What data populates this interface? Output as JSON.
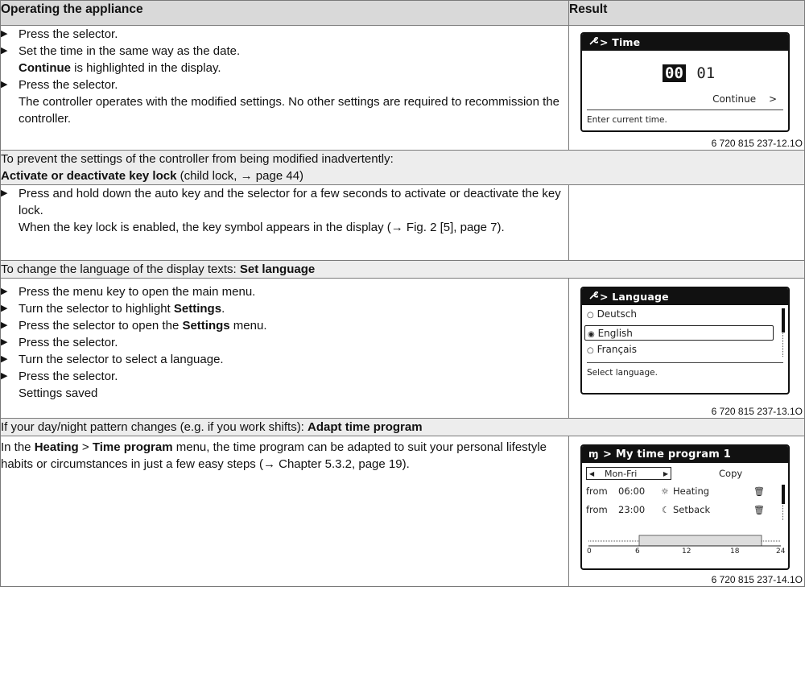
{
  "table": {
    "col1_header": "Operating the appliance",
    "col2_header": "Result"
  },
  "block1": {
    "steps": [
      {
        "text": "Press the selector."
      },
      {
        "text": "Set the time in the same way as the date.",
        "cont_bold": "Continue",
        "cont_rest": " is highlighted in the display."
      },
      {
        "text": "Press the selector.",
        "cont": "The controller operates with the modified settings. No other settings are required to recommission the controller."
      }
    ],
    "screen": {
      "title": "> Time",
      "icon": "wrench-icon",
      "hours": "00",
      "minutes": "01",
      "action": "Continue",
      "action_arrow": ">",
      "hint": "Enter current time."
    },
    "caption": "6 720 815 237-12.1O"
  },
  "section2": {
    "intro": "To prevent the settings of the controller from being modified inadvertently:",
    "title_bold": "Activate or deactivate key lock",
    "title_rest": " (child lock, → page 44)",
    "steps": [
      {
        "text": "Press and hold down the auto key and the selector for a few seconds to activate or deactivate the key lock.",
        "cont": "When the key lock is enabled, the key symbol appears in the display (→ Fig. 2 [5], page 7)."
      }
    ]
  },
  "section3": {
    "intro": "To change the language of the display texts: ",
    "title_bold": "Set language",
    "steps": [
      {
        "pre": "Press the menu key to open the main menu.",
        "bold": "",
        "post": ""
      },
      {
        "pre": "Turn the selector to highlight ",
        "bold": "Settings",
        "post": "."
      },
      {
        "pre": "Press the selector to open the ",
        "bold": "Settings",
        "post": " menu."
      },
      {
        "pre": "Press the selector.",
        "bold": "",
        "post": ""
      },
      {
        "pre": "Turn the selector to select a language.",
        "bold": "",
        "post": ""
      },
      {
        "pre": "Press the selector.",
        "bold": "",
        "post": "",
        "cont": "Settings saved"
      }
    ],
    "screen": {
      "title": "> Language",
      "icon": "wrench-icon",
      "options": [
        "Deutsch",
        "English",
        "Français"
      ],
      "selected": 1,
      "hint": "Select language."
    },
    "caption": "6 720 815 237-13.1O"
  },
  "section4": {
    "intro": "If your day/night pattern changes (e.g. if you work shifts): ",
    "title_bold": "Adapt time program",
    "body": {
      "p1": "In the ",
      "b1": "Heating",
      "p2": " > ",
      "b2": "Time program",
      "p3": " menu, the time program can be adapted to suit your personal lifestyle habits or circumstances in just a few easy steps (→ Chapter 5.3.2, page 19)."
    },
    "screen": {
      "title": "> My time program 1",
      "icon": "time-program-icon",
      "day": "Mon-Fri",
      "copy": "Copy",
      "rows": [
        {
          "from": "from",
          "time": "06:00",
          "mode": "Heating",
          "icon": "sun-icon"
        },
        {
          "from": "from",
          "time": "23:00",
          "mode": "Setback",
          "icon": "moon-icon"
        }
      ],
      "ticks": [
        "0",
        "6",
        "12",
        "18",
        "24"
      ]
    },
    "caption": "6 720 815 237-14.1O"
  }
}
